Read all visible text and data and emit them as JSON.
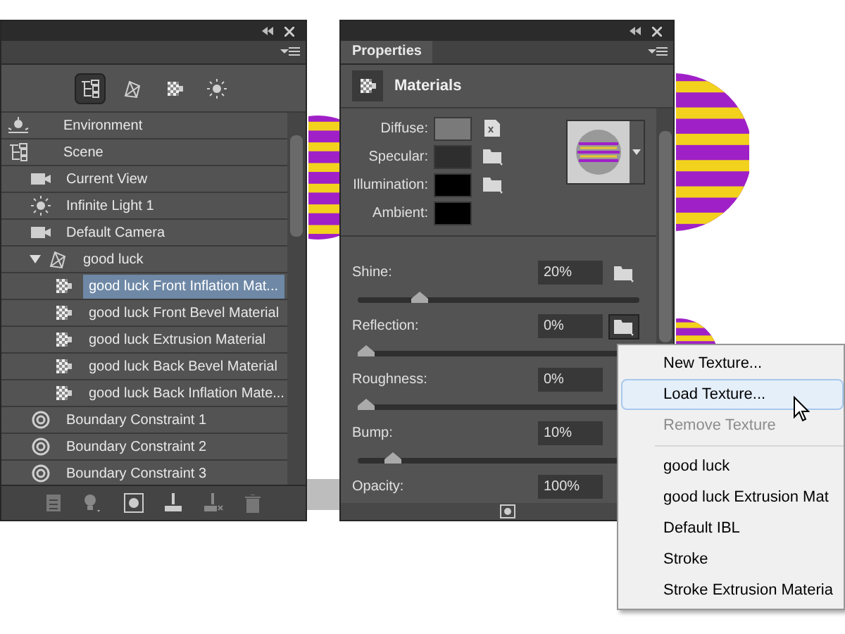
{
  "scene_panel": {
    "filters": [
      {
        "kind": "scene",
        "selected": true
      },
      {
        "kind": "mesh",
        "selected": false
      },
      {
        "kind": "material",
        "selected": false
      },
      {
        "kind": "light",
        "selected": false
      }
    ],
    "tree": [
      {
        "label": "Environment",
        "kind": "environment",
        "selected": false
      },
      {
        "label": "Scene",
        "kind": "scene",
        "selected": false,
        "children": [
          {
            "label": "Current View",
            "kind": "camera",
            "selected": false
          },
          {
            "label": "Infinite Light 1",
            "kind": "light",
            "selected": false
          },
          {
            "label": "Default Camera",
            "kind": "camera",
            "selected": false
          },
          {
            "label": "good luck",
            "kind": "mesh",
            "selected": false,
            "expanded": true,
            "children": [
              {
                "label": "good luck Front Inflation Mat...",
                "kind": "material",
                "selected": true
              },
              {
                "label": "good luck Front Bevel Material",
                "kind": "material",
                "selected": false
              },
              {
                "label": "good luck Extrusion Material",
                "kind": "material",
                "selected": false
              },
              {
                "label": "good luck Back Bevel Material",
                "kind": "material",
                "selected": false
              },
              {
                "label": "good luck Back Inflation Mate...",
                "kind": "material",
                "selected": false
              }
            ]
          },
          {
            "label": "Boundary Constraint 1",
            "kind": "constraint",
            "selected": false
          },
          {
            "label": "Boundary Constraint 2",
            "kind": "constraint",
            "selected": false
          },
          {
            "label": "Boundary Constraint 3",
            "kind": "constraint",
            "selected": false
          }
        ]
      }
    ]
  },
  "properties_panel": {
    "tab": "Properties",
    "header": "Materials",
    "swatches": [
      {
        "label": "Diffuse:",
        "color": "#7a7a7a",
        "kind": "texture"
      },
      {
        "label": "Specular:",
        "color": "#2e2e2e",
        "kind": "folder"
      },
      {
        "label": "Illumination:",
        "color": "#000000",
        "kind": "folder"
      },
      {
        "label": "Ambient:",
        "color": "#000000",
        "kind": "none"
      }
    ],
    "sliders": [
      {
        "label": "Shine:",
        "reading": "20%",
        "level": 0.2,
        "folder_button": {
          "active": false
        }
      },
      {
        "label": "Reflection:",
        "reading": "0%",
        "level": 0,
        "folder_button": {
          "active": true
        }
      },
      {
        "label": "Roughness:",
        "reading": "0%",
        "level": 0
      },
      {
        "label": "Bump:",
        "reading": "10%",
        "level": 0.1
      },
      {
        "label": "Opacity:",
        "reading": "100%"
      }
    ]
  },
  "texture_menu": {
    "sections": [
      [
        {
          "label": "New Texture...",
          "selected": false,
          "disabled": false
        },
        {
          "label": "Load Texture...",
          "selected": true,
          "disabled": false
        },
        {
          "label": "Remove Texture",
          "selected": false,
          "disabled": true
        }
      ],
      [
        {
          "label": "good luck",
          "selected": false,
          "disabled": false
        },
        {
          "label": "good luck Extrusion Mat",
          "selected": false,
          "disabled": false
        },
        {
          "label": "Default IBL",
          "selected": false,
          "disabled": false
        },
        {
          "label": "Stroke",
          "selected": false,
          "disabled": false
        },
        {
          "label": "Stroke Extrusion Materia",
          "selected": false,
          "disabled": false
        }
      ]
    ]
  }
}
